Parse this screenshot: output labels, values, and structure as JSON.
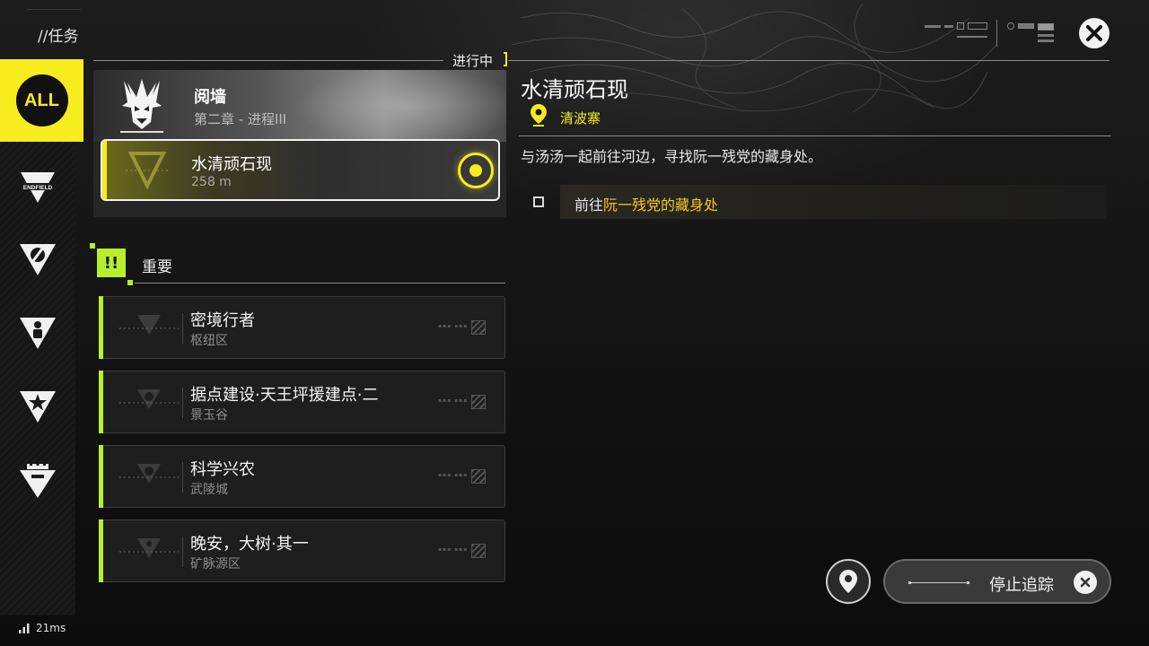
{
  "header": {
    "section_title": "//任务"
  },
  "sidebar": {
    "items": [
      {
        "id": "all",
        "label": "ALL",
        "icon": "all-badge-icon",
        "active": true
      },
      {
        "id": "endfield",
        "label": "ENDFIELD",
        "icon": "endfield-emblem-icon"
      },
      {
        "id": "faction",
        "icon": "compass-triangle-icon"
      },
      {
        "id": "person",
        "icon": "person-triangle-icon"
      },
      {
        "id": "star",
        "icon": "star-triangle-icon"
      },
      {
        "id": "building",
        "icon": "building-triangle-icon"
      }
    ]
  },
  "in_progress": {
    "label": "进行中",
    "chapter": {
      "title": "阅墙",
      "subtitle": "第二章 - 进程III"
    },
    "active_quest": {
      "title": "水清顽石现",
      "distance": "258 m"
    }
  },
  "important": {
    "label": "重要",
    "icon_text": "!!",
    "quests": [
      {
        "title": "密境行者",
        "region": "枢纽区"
      },
      {
        "title": "据点建设·天王坪援建点·二",
        "region": "景玉谷"
      },
      {
        "title": "科学兴农",
        "region": "武陵城"
      },
      {
        "title": "晚安，大树·其一",
        "region": "矿脉源区"
      }
    ]
  },
  "detail": {
    "title": "水清顽石现",
    "location": "清波寨",
    "description": "与汤汤一起前往河边，寻找阮一残党的藏身处。",
    "objective": {
      "prefix": "前往",
      "highlight": "阮一残党的藏身处"
    }
  },
  "controls": {
    "stop_tracking_label": "停止追踪"
  },
  "status": {
    "ping": "21ms"
  },
  "colors": {
    "accent_yellow": "#f6ec1e",
    "accent_green": "#b7f02a",
    "location_yellow": "#f6c81e"
  }
}
